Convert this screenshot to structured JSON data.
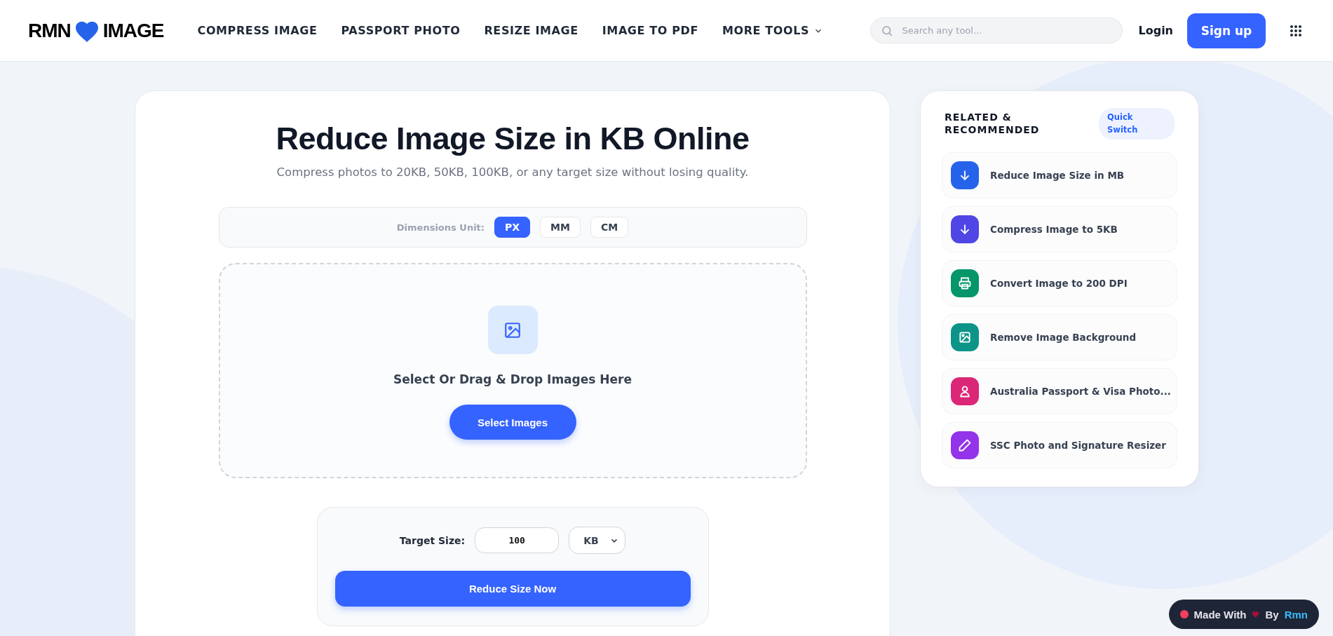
{
  "header": {
    "logo": {
      "left": "RMN",
      "right": "IMAGE"
    },
    "nav": [
      {
        "label": "COMPRESS IMAGE",
        "dropdown": false
      },
      {
        "label": "PASSPORT PHOTO",
        "dropdown": false
      },
      {
        "label": "RESIZE IMAGE",
        "dropdown": false
      },
      {
        "label": "IMAGE TO PDF",
        "dropdown": false
      },
      {
        "label": "MORE TOOLS",
        "dropdown": true
      }
    ],
    "search": {
      "placeholder": "Search any tool..."
    },
    "login": "Login",
    "signup": "Sign up"
  },
  "main": {
    "title": "Reduce Image Size in KB Online",
    "subtitle": "Compress photos to 20KB, 50KB, 100KB, or any target size without losing quality.",
    "units": {
      "label": "Dimensions Unit:",
      "options": [
        {
          "label": "PX",
          "selected": true
        },
        {
          "label": "MM",
          "selected": false
        },
        {
          "label": "CM",
          "selected": false
        }
      ]
    },
    "dropzone": {
      "text": "Select Or Drag & Drop Images Here",
      "button": "Select Images"
    },
    "target": {
      "label": "Target Size:",
      "value": "100",
      "unit": "KB",
      "button": "Reduce Size Now"
    }
  },
  "sidebar": {
    "title": "RELATED & RECOMMENDED",
    "badge": "Quick Switch",
    "items": [
      {
        "label": "Reduce Image Size in MB",
        "kind": "download",
        "color": "#2563eb"
      },
      {
        "label": "Compress Image to 5KB",
        "kind": "download",
        "color": "#4f46e5"
      },
      {
        "label": "Convert Image to 200 DPI",
        "kind": "printer",
        "color": "#059669"
      },
      {
        "label": "Remove Image Background",
        "kind": "image",
        "color": "#0d9488"
      },
      {
        "label": "Australia Passport & Visa Photo...",
        "kind": "person",
        "color": "#db2777"
      },
      {
        "label": "SSC Photo and Signature Resizer",
        "kind": "pencil",
        "color": "#9333ea"
      }
    ]
  },
  "badge": {
    "made": "Made With",
    "by": "By",
    "author": "Rmn"
  }
}
